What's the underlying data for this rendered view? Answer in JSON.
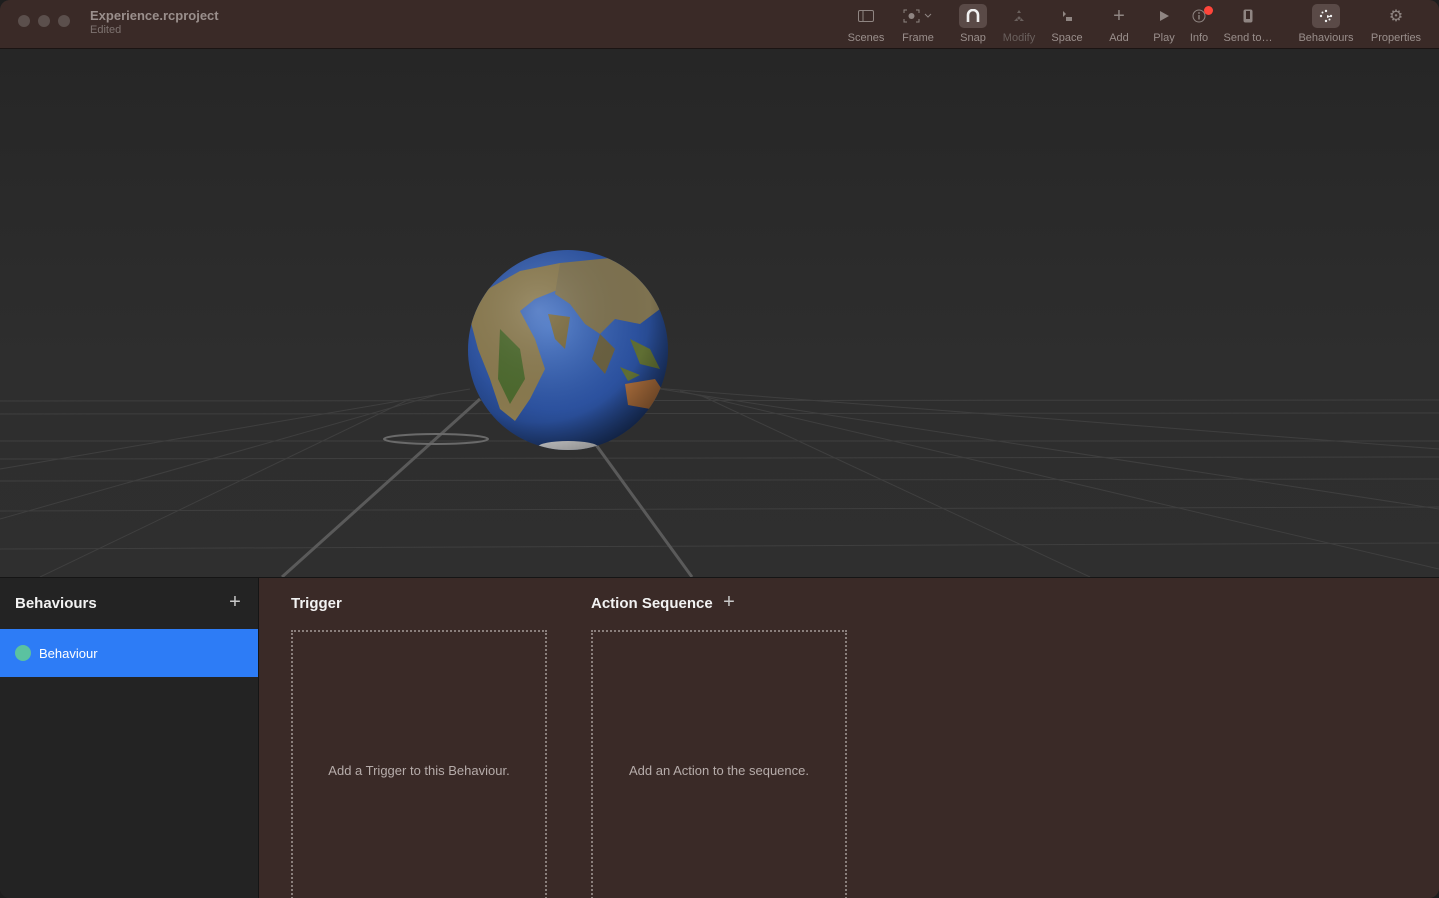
{
  "window": {
    "title": "Experience.rcproject",
    "subtitle": "Edited"
  },
  "toolbar": {
    "items": [
      {
        "label": "Scenes",
        "icon": "sidebar-icon"
      },
      {
        "label": "Frame",
        "icon": "frame-icon"
      },
      {
        "label": "Snap",
        "icon": "magnet-icon",
        "active": true
      },
      {
        "label": "Modify",
        "icon": "modify-icon",
        "disabled": true
      },
      {
        "label": "Space",
        "icon": "space-icon"
      },
      {
        "label": "Add",
        "icon": "plus-icon"
      },
      {
        "label": "Play",
        "icon": "play-icon"
      },
      {
        "label": "Info",
        "icon": "info-icon",
        "badge": true
      },
      {
        "label": "Send to…",
        "icon": "device-icon"
      },
      {
        "label": "Behaviours",
        "icon": "behaviours-icon",
        "active": true
      },
      {
        "label": "Properties",
        "icon": "gear-icon"
      }
    ]
  },
  "sidebar": {
    "title": "Behaviours",
    "items": [
      {
        "label": "Behaviour",
        "color": "#5bc2a0",
        "selected": true
      }
    ]
  },
  "trigger": {
    "title": "Trigger",
    "placeholder": "Add a Trigger to this Behaviour."
  },
  "action_sequence": {
    "title": "Action Sequence",
    "placeholder": "Add an Action to the sequence."
  },
  "colors": {
    "accent": "#2d7cf6",
    "chrome": "#3a2a27",
    "badge": "#ff453a"
  }
}
